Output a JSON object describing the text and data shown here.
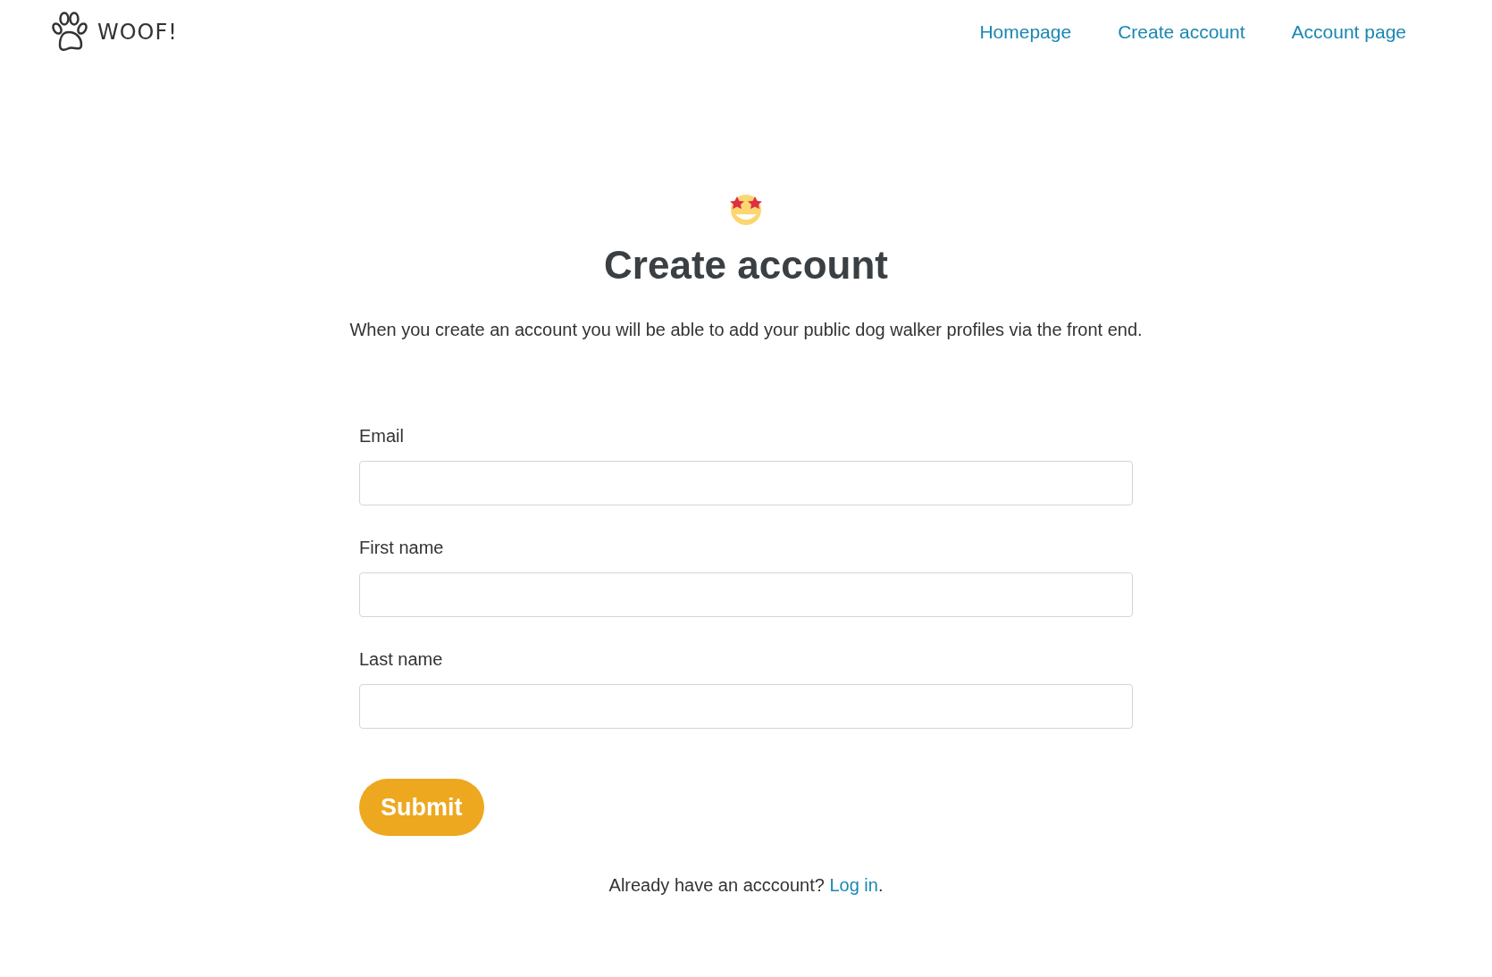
{
  "brand": {
    "name": "WOOF!"
  },
  "nav": [
    {
      "label": "Homepage"
    },
    {
      "label": "Create account"
    },
    {
      "label": "Account page"
    }
  ],
  "title": "Create account",
  "description": "When you create an account you will be able to add your public dog walker profiles via the front end.",
  "fields": [
    {
      "label": "Email"
    },
    {
      "label": "First name"
    },
    {
      "label": "Last name"
    }
  ],
  "submit": "Submit",
  "footer": {
    "text": "Already have an acccount?",
    "link": "Log in",
    "after": "."
  }
}
